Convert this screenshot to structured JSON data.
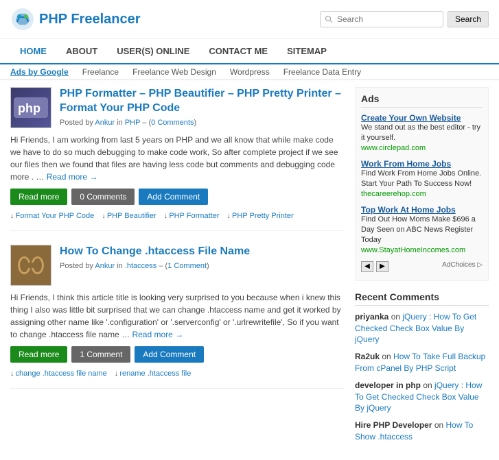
{
  "header": {
    "logo_text": "PHP Freelancer",
    "search_placeholder": "Search",
    "search_btn": "Search"
  },
  "nav": {
    "items": [
      {
        "label": "HOME",
        "active": true
      },
      {
        "label": "ABOUT",
        "active": false
      },
      {
        "label": "USER(S) ONLINE",
        "active": false
      },
      {
        "label": "CONTACT ME",
        "active": false
      },
      {
        "label": "SITEMAP",
        "active": false
      }
    ]
  },
  "ads_bar": {
    "label": "Ads by Google",
    "links": [
      "Freelance",
      "Freelance Web Design",
      "Wordpress",
      "Freelance Data Entry"
    ]
  },
  "posts": [
    {
      "id": 1,
      "title": "PHP Formatter – PHP Beautifier – PHP Pretty Printer – Format Your PHP Code",
      "author": "Ankur",
      "category": "PHP",
      "comments_count": "0 Comments",
      "excerpt": "Hi Friends, I am working from last 5 years on PHP and we all know that while make code we have to do so much debugging to make code work, So after complete project if we see our files then we found that files are having less code but comments and debugging code more . …",
      "read_more": "Read more →",
      "btn_read": "Read more",
      "btn_comments": "0 Comments",
      "btn_add": "Add Comment",
      "tags": [
        "Format Your PHP Code",
        "PHP Beautifier",
        "PHP Formatter",
        "PHP Pretty Printer"
      ]
    },
    {
      "id": 2,
      "title": "How To Change .htaccess File Name",
      "author": "Ankur",
      "category": ".htaccess",
      "comments_count": "1 Comment",
      "excerpt": "Hi Friends, I think this article title is looking very surprised to you because when i knew this thing I also was little bit surprised that we can change .htaccess name and get it worked by assigning other name like '.configuration' or '.serverconfig' or '.urlrewritefile', So if you want to change .htaccess file name … ",
      "read_more": "Read more →",
      "btn_read": "Read more",
      "btn_comments": "1 Comment",
      "btn_add": "Add Comment",
      "tags": [
        "change .htaccess file name",
        "rename .htaccess file"
      ]
    }
  ],
  "sidebar": {
    "ads_title": "Ads",
    "ads": [
      {
        "title": "Create Your Own Website",
        "desc": "We stand out as the best editor - try it yourself.",
        "url": "www.circlepad.com"
      },
      {
        "title": "Work From Home Jobs",
        "desc": "Find Work From Home Jobs Online. Start Your Path To Success Now!",
        "url": "thecareerehop.com"
      },
      {
        "title": "Top Work At Home Jobs",
        "desc": "Find Out How Moms Make $696 a Day Seen on ABC News Register Today",
        "url": "www.StayatHomeIncomes.com"
      }
    ],
    "adchoices": "AdChoices ▷",
    "recent_title": "Recent Comments",
    "comments": [
      {
        "commenter": "priyanka",
        "action": "on",
        "link_text": "jQuery : How To Get Checked Check Box Value By jQuery"
      },
      {
        "commenter": "Ra2uk",
        "action": "on",
        "link_text": "How To Take Full Backup From cPanel By PHP Script"
      },
      {
        "commenter": "developer in php",
        "action": "on",
        "link_text": "jQuery : How To Get Checked Check Box Value By jQuery"
      },
      {
        "commenter": "Hire PHP Developer",
        "action": "on",
        "link_text": "How To Show .htaccess"
      }
    ]
  }
}
